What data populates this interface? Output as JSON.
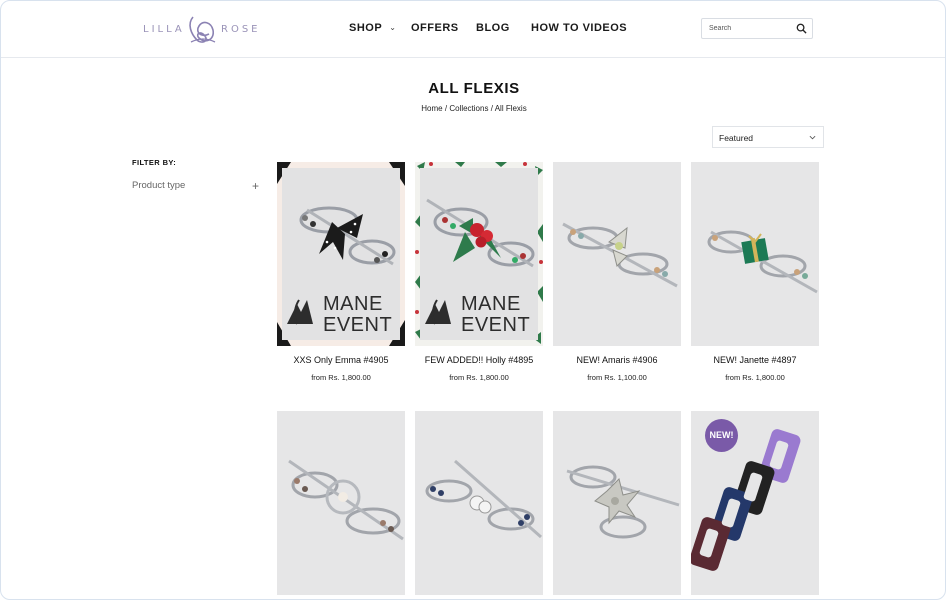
{
  "header": {
    "logo_left": "LILLA",
    "logo_right": "ROSE",
    "nav": [
      {
        "label": "SHOP"
      },
      {
        "label": "OFFERS"
      },
      {
        "label": "BLOG"
      },
      {
        "label": "HOW TO VIDEOS"
      }
    ],
    "search": {
      "placeholder": "Search"
    }
  },
  "page": {
    "title": "ALL FLEXIS",
    "breadcrumb": [
      "Home",
      "Collections",
      "All Flexis"
    ],
    "breadcrumb_sep": "/"
  },
  "sort": {
    "selected": "Featured"
  },
  "filter": {
    "title": "FILTER BY:",
    "groups": [
      {
        "label": "Product type",
        "toggle": "+"
      }
    ]
  },
  "products": [
    {
      "name": "XXS Only Emma #4905",
      "price": "from Rs. 1,800.00",
      "overlay": [
        "MANE",
        "EVENT"
      ]
    },
    {
      "name": "FEW ADDED!! Holly #4895",
      "price": "from Rs. 1,800.00",
      "overlay": [
        "MANE",
        "EVENT"
      ]
    },
    {
      "name": "NEW! Amaris #4906",
      "price": "from Rs. 1,100.00"
    },
    {
      "name": "NEW! Janette #4897",
      "price": "from Rs. 1,800.00"
    },
    {
      "name": "",
      "price": ""
    },
    {
      "name": "",
      "price": ""
    },
    {
      "name": "",
      "price": ""
    },
    {
      "name": "",
      "price": "",
      "badge": "NEW!"
    }
  ],
  "colors": {
    "brand_purple": "#7a5aa8",
    "logo_lavender": "#9a93b8",
    "text": "#111111",
    "border": "#e1e4e8"
  }
}
